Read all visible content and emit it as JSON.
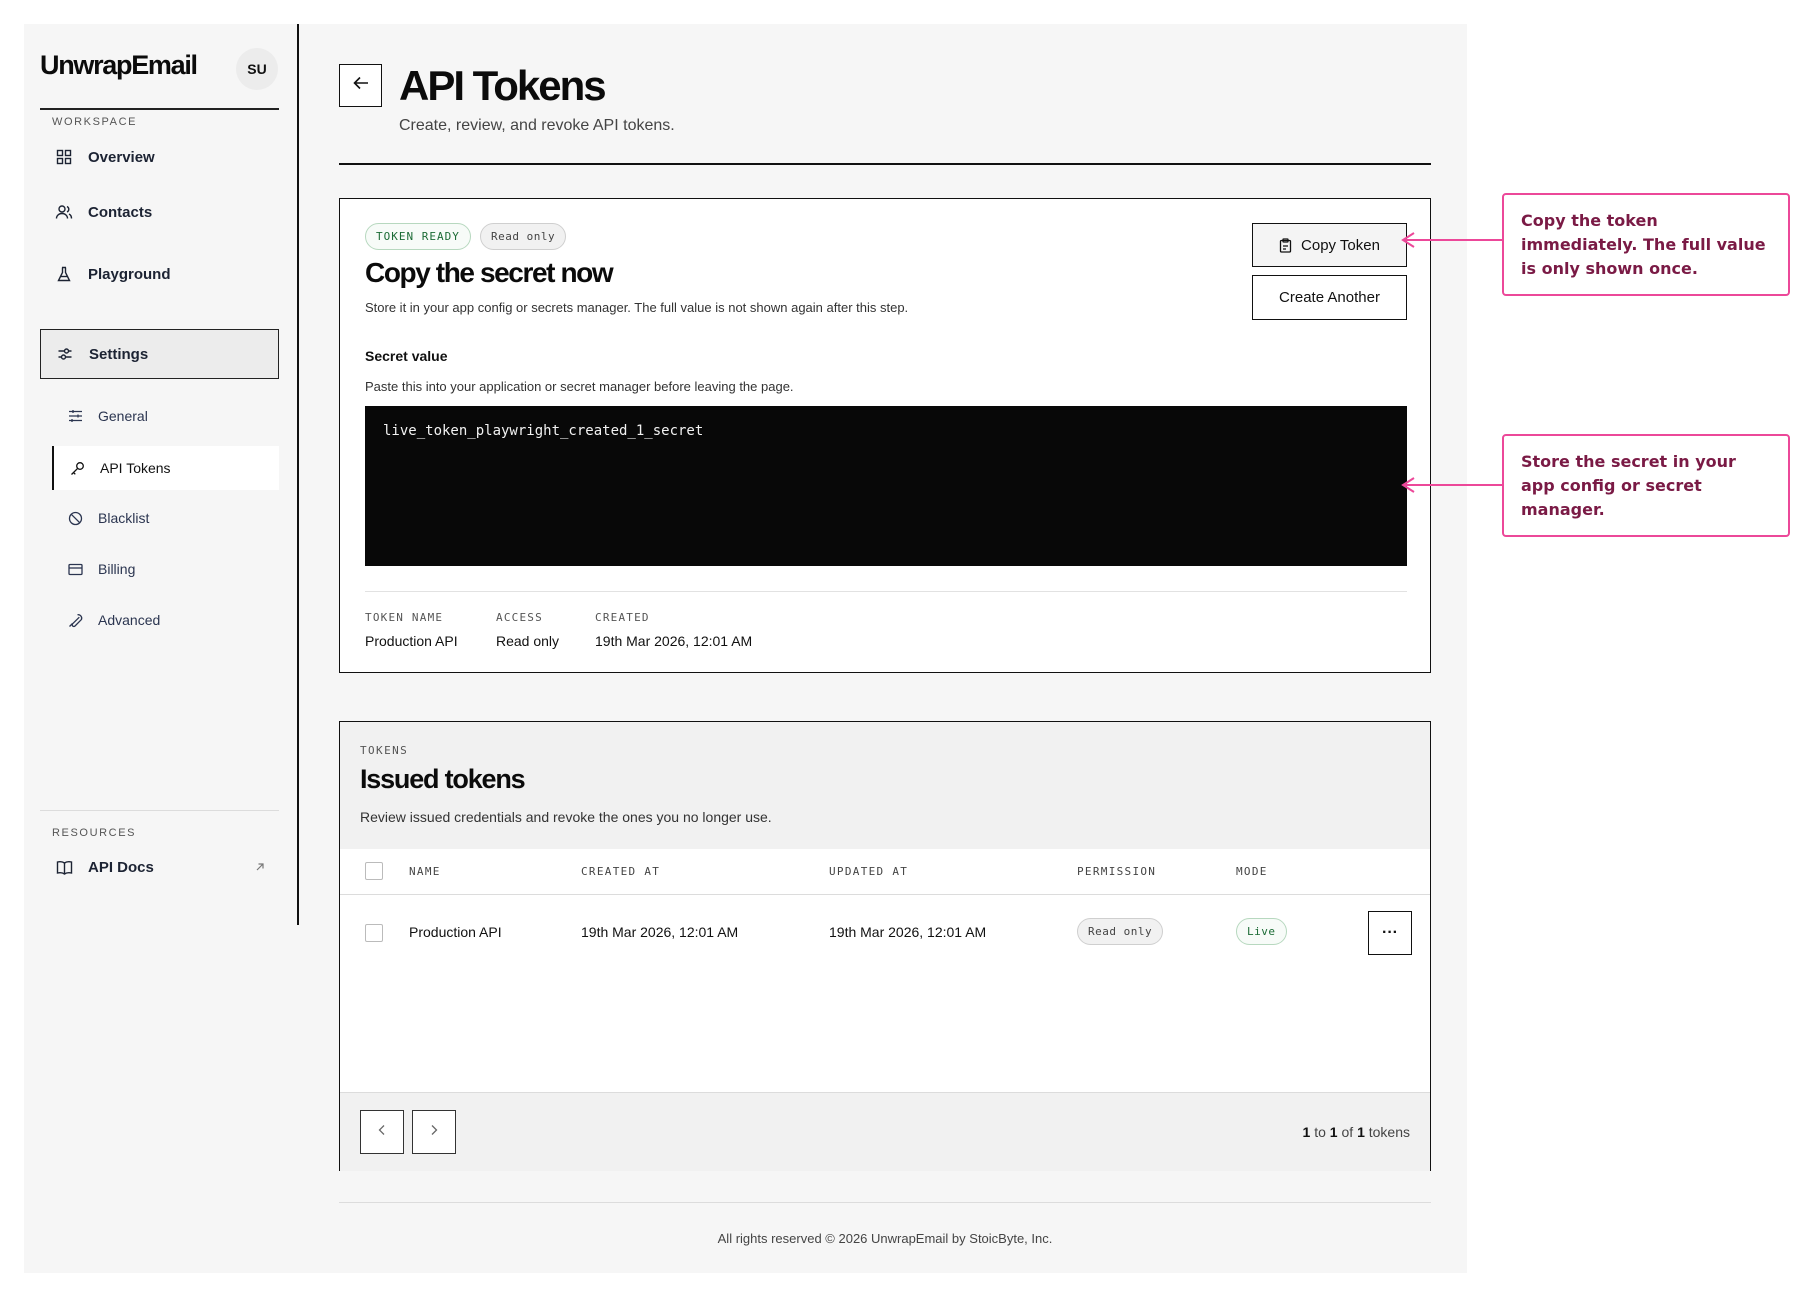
{
  "app": {
    "brand": "UnwrapEmail",
    "avatar_initials": "SU"
  },
  "sidebar": {
    "workspace_label": "WORKSPACE",
    "items": [
      {
        "label": "Overview",
        "icon": "grid-icon"
      },
      {
        "label": "Contacts",
        "icon": "users-icon"
      },
      {
        "label": "Playground",
        "icon": "flask-icon"
      },
      {
        "label": "Settings",
        "icon": "sliders-icon",
        "active": true
      }
    ],
    "settings_items": [
      {
        "label": "General",
        "icon": "sliders-horizontal-icon"
      },
      {
        "label": "API Tokens",
        "icon": "key-icon",
        "active": true
      },
      {
        "label": "Blacklist",
        "icon": "ban-icon"
      },
      {
        "label": "Billing",
        "icon": "credit-card-icon"
      },
      {
        "label": "Advanced",
        "icon": "wrench-icon"
      }
    ],
    "resources_label": "RESOURCES",
    "resources": [
      {
        "label": "API Docs",
        "icon": "book-icon",
        "external_icon": "arrow-up-right-icon"
      }
    ]
  },
  "header": {
    "back_icon": "arrow-left-icon",
    "title": "API Tokens",
    "subtitle": "Create, review, and revoke API tokens."
  },
  "secret_card": {
    "status_badge": "TOKEN READY",
    "access_badge": "Read only",
    "title": "Copy the secret now",
    "description": "Store it in your app config or secrets manager. The full value is not shown again after this step.",
    "copy_button": "Copy Token",
    "copy_icon": "clipboard-icon",
    "create_button": "Create Another",
    "secret_label": "Secret value",
    "secret_hint": "Paste this into your application or secret manager before leaving the page.",
    "secret_value": "live_token_playwright_created_1_secret",
    "meta": {
      "name_label": "TOKEN NAME",
      "name_value": "Production API",
      "access_label": "ACCESS",
      "access_value": "Read only",
      "created_label": "CREATED",
      "created_value": "19th Mar 2026, 12:01 AM"
    }
  },
  "tokens": {
    "eyebrow": "TOKENS",
    "title": "Issued tokens",
    "description": "Review issued credentials and revoke the ones you no longer use.",
    "columns": [
      "NAME",
      "CREATED AT",
      "UPDATED AT",
      "PERMISSION",
      "MODE"
    ],
    "rows": [
      {
        "name": "Production API",
        "created_at": "19th Mar 2026, 12:01 AM",
        "updated_at": "19th Mar 2026, 12:01 AM",
        "permission": "Read only",
        "mode": "Live",
        "menu": "···"
      }
    ],
    "pager": {
      "from": "1",
      "to_word": "to",
      "to": "1",
      "of_word": "of",
      "total": "1",
      "unit": "tokens"
    }
  },
  "footer": {
    "text": "All rights reserved © 2026 UnwrapEmail by StoicByte, Inc."
  },
  "annotations": [
    "Copy the token immediately. The full value is only shown once.",
    "Store the secret in your app config or secret manager."
  ],
  "colors": {
    "accent_annotation": "#ec4899",
    "annotation_text": "#7a1a45",
    "badge_green": "#1b6b35",
    "secret_bg": "#080808"
  }
}
